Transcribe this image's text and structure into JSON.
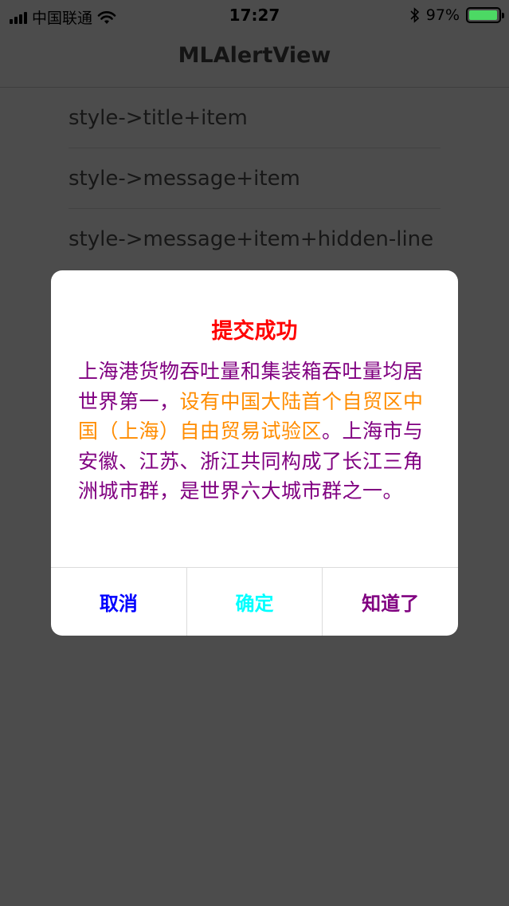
{
  "status_bar": {
    "carrier": "中国联通",
    "time": "17:27",
    "battery_percent": "97%",
    "battery_level": 0.97,
    "icons": [
      "signal-icon",
      "wifi-icon",
      "bluetooth-icon",
      "battery-icon"
    ]
  },
  "nav": {
    "title": "MLAlertView"
  },
  "list": {
    "items": [
      {
        "label": "style->title+item"
      },
      {
        "label": "style->message+item"
      },
      {
        "label": "style->message+item+hidden-line"
      }
    ]
  },
  "alert": {
    "title": "提交成功",
    "title_color": "#ff0000",
    "message_part1": "上海港货物吞吐量和集装箱吞吐量均居世界第一，",
    "message_part2": "设有中国大陆首个自贸区中国（上海）自由贸易试验区",
    "message_part3": "。上海市与安徽、江苏、浙江共同构成了长江三角洲城市群，是世界六大城市群之一。",
    "message_colors": {
      "primary": "#800080",
      "highlight": "#ff8c00"
    },
    "buttons": [
      {
        "label": "取消",
        "color": "#0000ff"
      },
      {
        "label": "确定",
        "color": "#00ffff"
      },
      {
        "label": "知道了",
        "color": "#800080"
      }
    ]
  }
}
